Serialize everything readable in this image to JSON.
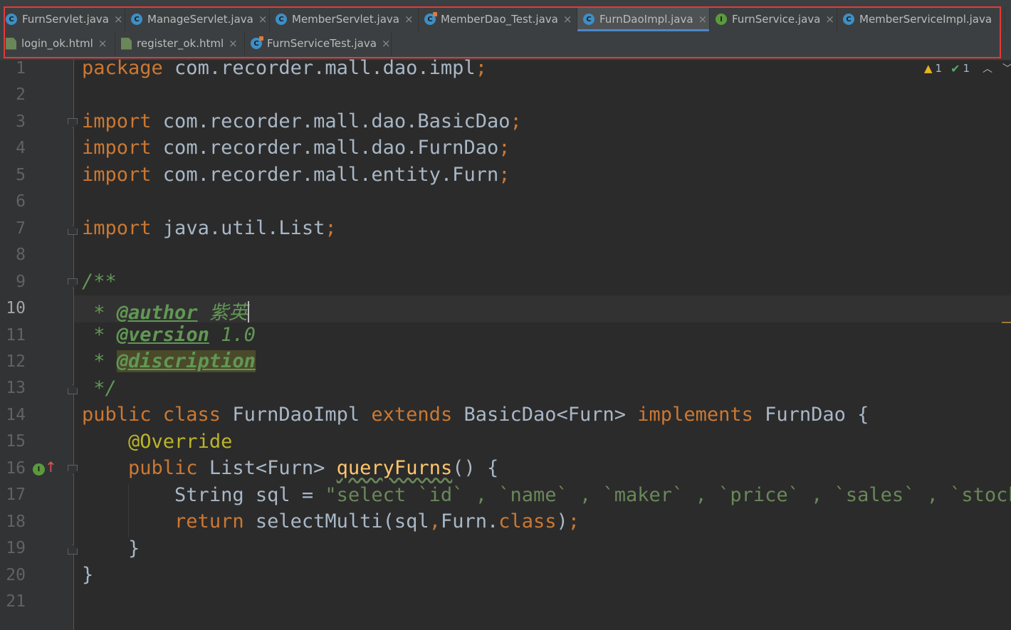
{
  "tabs": {
    "row1": [
      {
        "label": "FurnServlet.java",
        "icon": "class",
        "active": false
      },
      {
        "label": "ManageServlet.java",
        "icon": "class",
        "active": false
      },
      {
        "label": "MemberServlet.java",
        "icon": "class",
        "active": false
      },
      {
        "label": "MemberDao_Test.java",
        "icon": "test",
        "active": false
      },
      {
        "label": "FurnDaoImpl.java",
        "icon": "class",
        "active": true
      },
      {
        "label": "FurnService.java",
        "icon": "interface",
        "active": false
      },
      {
        "label": "MemberServiceImpl.java",
        "icon": "class",
        "active": false
      }
    ],
    "row2": [
      {
        "label": "login_ok.html",
        "icon": "html",
        "active": false
      },
      {
        "label": "register_ok.html",
        "icon": "html",
        "active": false
      },
      {
        "label": "FurnServiceTest.java",
        "icon": "test",
        "active": false
      }
    ],
    "close_glyph": "×",
    "class_glyph": "C",
    "interface_glyph": "I"
  },
  "editor": {
    "current_line": 10,
    "line_numbers": [
      "1",
      "2",
      "3",
      "4",
      "5",
      "6",
      "7",
      "8",
      "9",
      "10",
      "11",
      "12",
      "13",
      "14",
      "15",
      "16",
      "17",
      "18",
      "19",
      "20",
      "21"
    ],
    "inspections": {
      "warnings": "1",
      "passed": "1"
    },
    "code": {
      "l1": {
        "kw": "package",
        "rest": " com.recorder.mall.dao.impl",
        "semi": ";"
      },
      "l3": {
        "kw": "import",
        "rest": " com.recorder.mall.dao.BasicDao",
        "semi": ";"
      },
      "l4": {
        "kw": "import",
        "rest": " com.recorder.mall.dao.FurnDao",
        "semi": ";"
      },
      "l5": {
        "kw": "import",
        "rest": " com.recorder.mall.entity.Furn",
        "semi": ";"
      },
      "l7": {
        "kw": "import",
        "rest": " java.util.List",
        "semi": ";"
      },
      "l9": {
        "doc": "/**"
      },
      "l10": {
        "star": " * ",
        "tag": "@author",
        "text": " 紫英"
      },
      "l11": {
        "star": " * ",
        "tag": "@version",
        "text": " 1.0"
      },
      "l12": {
        "star": " * ",
        "tag": "@discription"
      },
      "l13": {
        "doc": " */"
      },
      "l14": {
        "kw1": "public class",
        "t1": " FurnDaoImpl ",
        "kw2": "extends",
        "t2": " BasicDao<Furn> ",
        "kw3": "implements",
        "t3": " FurnDao {"
      },
      "l15": {
        "indent": "    ",
        "ann": "@Override"
      },
      "l16": {
        "indent": "    ",
        "kw": "public",
        "t1": " List<Furn> ",
        "fn": "queryFurns",
        "t2": "() {"
      },
      "l17": {
        "indent": "        ",
        "t1": "String sql = ",
        "str": "\"select `id` , `name` , `maker` , `price` , `sales` , `stock` , `img_path` from `furn`\"",
        "semi": ";"
      },
      "l18": {
        "indent": "        ",
        "kw": "return",
        "t1": " selectMulti(sql",
        "comma": ",",
        "t2": "Furn.",
        "kw2": "class",
        "t3": ")",
        "semi": ";"
      },
      "l19": {
        "text": "    }"
      },
      "l20": {
        "text": "}"
      }
    }
  },
  "icons": {
    "warning": "warning-triangle-icon",
    "check": "double-check-icon",
    "prev": "chevron-up-icon",
    "next": "chevron-down-icon",
    "implements": "implements-method-icon"
  },
  "colors": {
    "background": "#2b2b2b",
    "keyword": "#cc7832",
    "string": "#6a8759",
    "javadoc": "#629755",
    "annotation": "#bbb529",
    "method": "#ffc66d",
    "active_tab_underline": "#4a88c7",
    "highlight_box": "#e53935"
  }
}
